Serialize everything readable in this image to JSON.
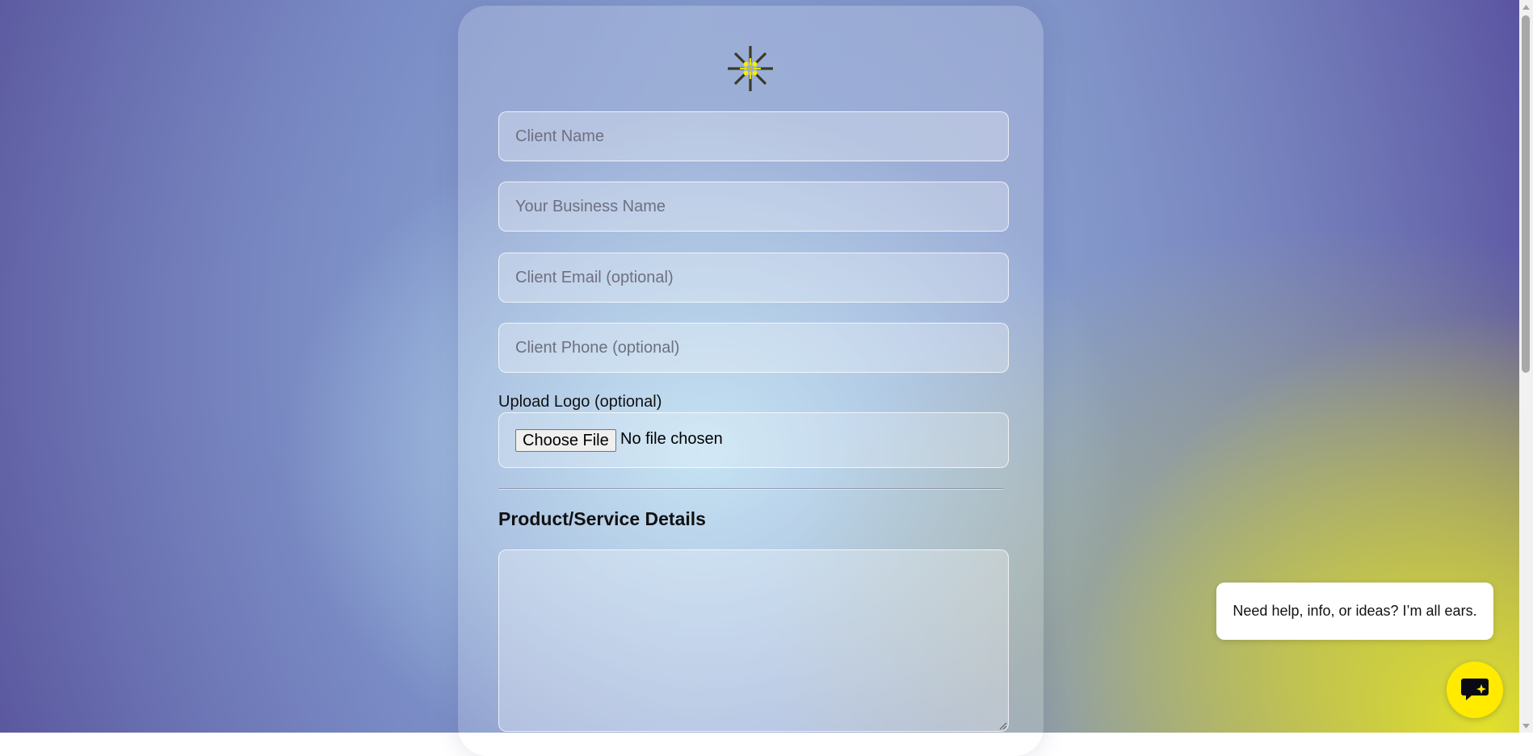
{
  "form": {
    "logo_icon": "sunburst-logo-icon",
    "client_name_placeholder": "Client Name",
    "business_name_placeholder": "Your Business Name",
    "client_email_placeholder": "Client Email (optional)",
    "client_phone_placeholder": "Client Phone (optional)",
    "upload_label": "Upload Logo (optional)",
    "choose_file_label": "Choose File",
    "no_file_text": "No file chosen",
    "section_heading": "Product/Service Details",
    "details_value": ""
  },
  "chat": {
    "bubble_text": "Need help, info, or ideas? I’m all ears.",
    "button_icon": "chat-sparkle-icon",
    "button_color": "#ffea00"
  },
  "scrollbar": {
    "up_icon": "scroll-up-arrow-icon",
    "down_icon": "scroll-down-arrow-icon"
  }
}
